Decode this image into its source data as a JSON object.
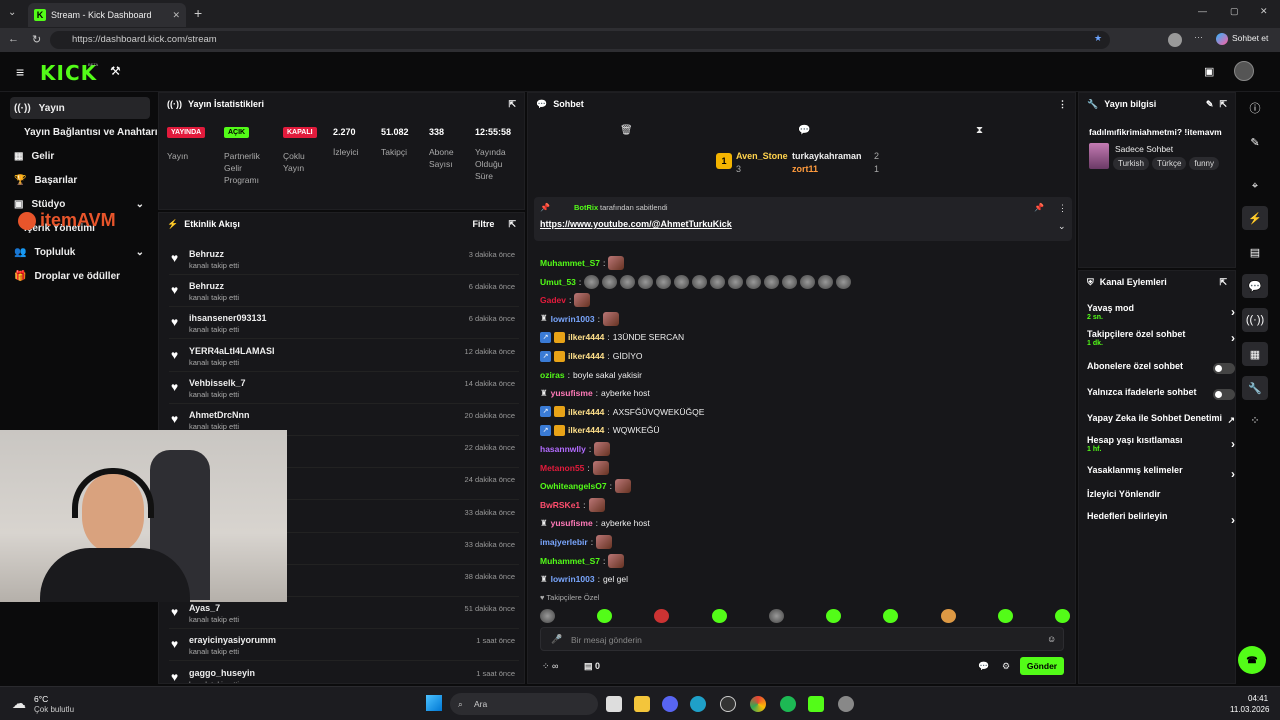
{
  "browser": {
    "tab_title": "Stream - Kick Dashboard",
    "url": "https://dashboard.kick.com/stream",
    "profile": "Sohbet et"
  },
  "app": {
    "logo": "KICK",
    "beta": "BETA"
  },
  "nav": [
    {
      "label": "Yayın"
    },
    {
      "label": "Yayın Bağlantısı ve Anahtarı"
    },
    {
      "label": "Gelir"
    },
    {
      "label": "Başarılar"
    },
    {
      "label": "Stüdyo"
    },
    {
      "label": "İçerik Yönetimi"
    },
    {
      "label": "Topluluk"
    },
    {
      "label": "Droplar ve ödüller"
    }
  ],
  "overlay_brand": "itemAVM",
  "stats": {
    "title": "Yayın İstatistikleri",
    "pills": [
      {
        "label": "YAYINDA",
        "desc": "Yayın",
        "color": "#e21b3c"
      },
      {
        "label": "AÇIK",
        "desc": "Partnerlik Gelir Programı",
        "color": "#53fc18"
      },
      {
        "label": "KAPALI",
        "desc": "Çoklu Yayın",
        "color": "#e21b3c"
      }
    ],
    "values": [
      {
        "v": "2.270",
        "l": "İzleyici"
      },
      {
        "v": "51.082",
        "l": "Takipçi"
      },
      {
        "v": "338",
        "l": "Abone Sayısı"
      },
      {
        "v": "12:55:58",
        "l": "Yayında Olduğu Süre"
      }
    ]
  },
  "activity": {
    "title": "Etkinlik Akışı",
    "filter": "Filtre",
    "items": [
      {
        "name": "Behruzz",
        "desc": "kanalı takip etti",
        "time": "3 dakika önce"
      },
      {
        "name": "Behruzz",
        "desc": "kanalı takip etti",
        "time": "6 dakika önce"
      },
      {
        "name": "ihsansener093131",
        "desc": "kanalı takip etti",
        "time": "6 dakika önce"
      },
      {
        "name": "YERR4aLtI4LAMASI",
        "desc": "kanalı takip etti",
        "time": "12 dakika önce"
      },
      {
        "name": "Vehbisselk_7",
        "desc": "kanalı takip etti",
        "time": "14 dakika önce"
      },
      {
        "name": "AhmetDrcNnn",
        "desc": "kanalı takip etti",
        "time": "20 dakika önce"
      },
      {
        "name": "",
        "desc": "",
        "time": "22 dakika önce"
      },
      {
        "name": "",
        "desc": "",
        "time": "24 dakika önce"
      },
      {
        "name": "",
        "desc": "",
        "time": "33 dakika önce"
      },
      {
        "name": "",
        "desc": "",
        "time": "33 dakika önce"
      },
      {
        "name": "",
        "desc": "",
        "time": "38 dakika önce"
      },
      {
        "name": "Ayas_7",
        "desc": "kanalı takip etti",
        "time": "51 dakika önce"
      },
      {
        "name": "erayicinyasiyorumm",
        "desc": "kanalı takip etti",
        "time": "1 saat önce"
      },
      {
        "name": "gaggo_huseyin",
        "desc": "kanalı takip etti",
        "time": "1 saat önce"
      }
    ]
  },
  "chat": {
    "title": "Sohbet",
    "leaders": [
      {
        "rank": "1",
        "name": "Aven_Stone",
        "count": "3"
      },
      {
        "name": "turkaykahraman",
        "count": "2"
      },
      {
        "name": "zort11",
        "count": "1"
      }
    ],
    "pinned": {
      "by": "BotRix",
      "suffix": "tarafından sabitlendi",
      "link": "https://www.youtube.com/@AhmetTurkuKick"
    },
    "messages": [
      {
        "user": "Muhammet_S7",
        "color": "#53fc18",
        "text": "",
        "emotes": 1
      },
      {
        "user": "Umut_53",
        "color": "#53fc18",
        "text": "",
        "emotes": 15
      },
      {
        "user": "Gadev",
        "color": "#e21b3c",
        "text": "",
        "emotes": 1
      },
      {
        "user": "lowrin1003",
        "color": "#7aa7ff",
        "text": "",
        "emotes": 1
      },
      {
        "user": "ilker4444",
        "color": "#ffe08a",
        "text": "13ÜNDE SERCAN",
        "emotes": 0
      },
      {
        "user": "ilker4444",
        "color": "#ffe08a",
        "text": "GİDİYO",
        "emotes": 0
      },
      {
        "user": "oziras",
        "color": "#53fc18",
        "text": "boyle sakal yakisir",
        "emotes": 0
      },
      {
        "user": "yusufisme",
        "color": "#ff7ab8",
        "text": "ayberke host",
        "emotes": 0
      },
      {
        "user": "ilker4444",
        "color": "#ffe08a",
        "text": "AXSFĞÜVQWEKÜĞQE",
        "emotes": 0
      },
      {
        "user": "ilker4444",
        "color": "#ffe08a",
        "text": "WQWKEĞÜ",
        "emotes": 0
      },
      {
        "user": "hasannwlly",
        "color": "#b36bff",
        "text": "",
        "emotes": 1
      },
      {
        "user": "Metanon55",
        "color": "#e21b3c",
        "text": "",
        "emotes": 1
      },
      {
        "user": "OwhiteangelsO7",
        "color": "#53fc18",
        "text": "",
        "emotes": 1
      },
      {
        "user": "BwRSKe1",
        "color": "#ff4d6d",
        "text": "",
        "emotes": 1
      },
      {
        "user": "yusufisme",
        "color": "#ff7ab8",
        "text": "ayberke host",
        "emotes": 0
      },
      {
        "user": "imajyerlebir",
        "color": "#7aa7ff",
        "text": "",
        "emotes": 1
      },
      {
        "user": "Muhammet_S7",
        "color": "#53fc18",
        "text": "",
        "emotes": 1
      },
      {
        "user": "lowrin1003",
        "color": "#7aa7ff",
        "text": "gel gel",
        "emotes": 0
      }
    ],
    "followers_only": "Takipçilere Özel",
    "placeholder": "Bir mesaj gönderin",
    "send": "Gönder",
    "viewer_count": "0"
  },
  "info": {
    "title": "Yayın bilgisi",
    "stream_title": "fadılmıfikrimiahmetmi? !itemavm",
    "category": "Sadece Sohbet",
    "tags": [
      "Turkish",
      "Türkçe",
      "funny"
    ]
  },
  "actions": {
    "title": "Kanal Eylemleri",
    "items": [
      {
        "label": "Yavaş mod",
        "sub": "2 sn.",
        "ctl": "chev"
      },
      {
        "label": "Takipçilere özel sohbet",
        "sub": "1 dk.",
        "ctl": "chev"
      },
      {
        "label": "Abonelere özel sohbet",
        "sub": "",
        "ctl": "toggle"
      },
      {
        "label": "Yalnızca ifadelerle sohbet",
        "sub": "",
        "ctl": "toggle"
      },
      {
        "label": "Yapay Zeka ile Sohbet Denetimi",
        "sub": "",
        "ctl": "ext"
      },
      {
        "label": "Hesap yaşı kısıtlaması",
        "sub": "1 hf.",
        "ctl": "chev"
      },
      {
        "label": "Yasaklanmış kelimeler",
        "sub": "",
        "ctl": "chev"
      },
      {
        "label": "İzleyici Yönlendir",
        "sub": "",
        "ctl": "none"
      },
      {
        "label": "Hedefleri belirleyin",
        "sub": "",
        "ctl": "chev"
      }
    ]
  },
  "taskbar": {
    "temp": "6°C",
    "weather": "Çok bulutlu",
    "search": "Ara",
    "time": "04:41",
    "date": "11.03.2026"
  }
}
